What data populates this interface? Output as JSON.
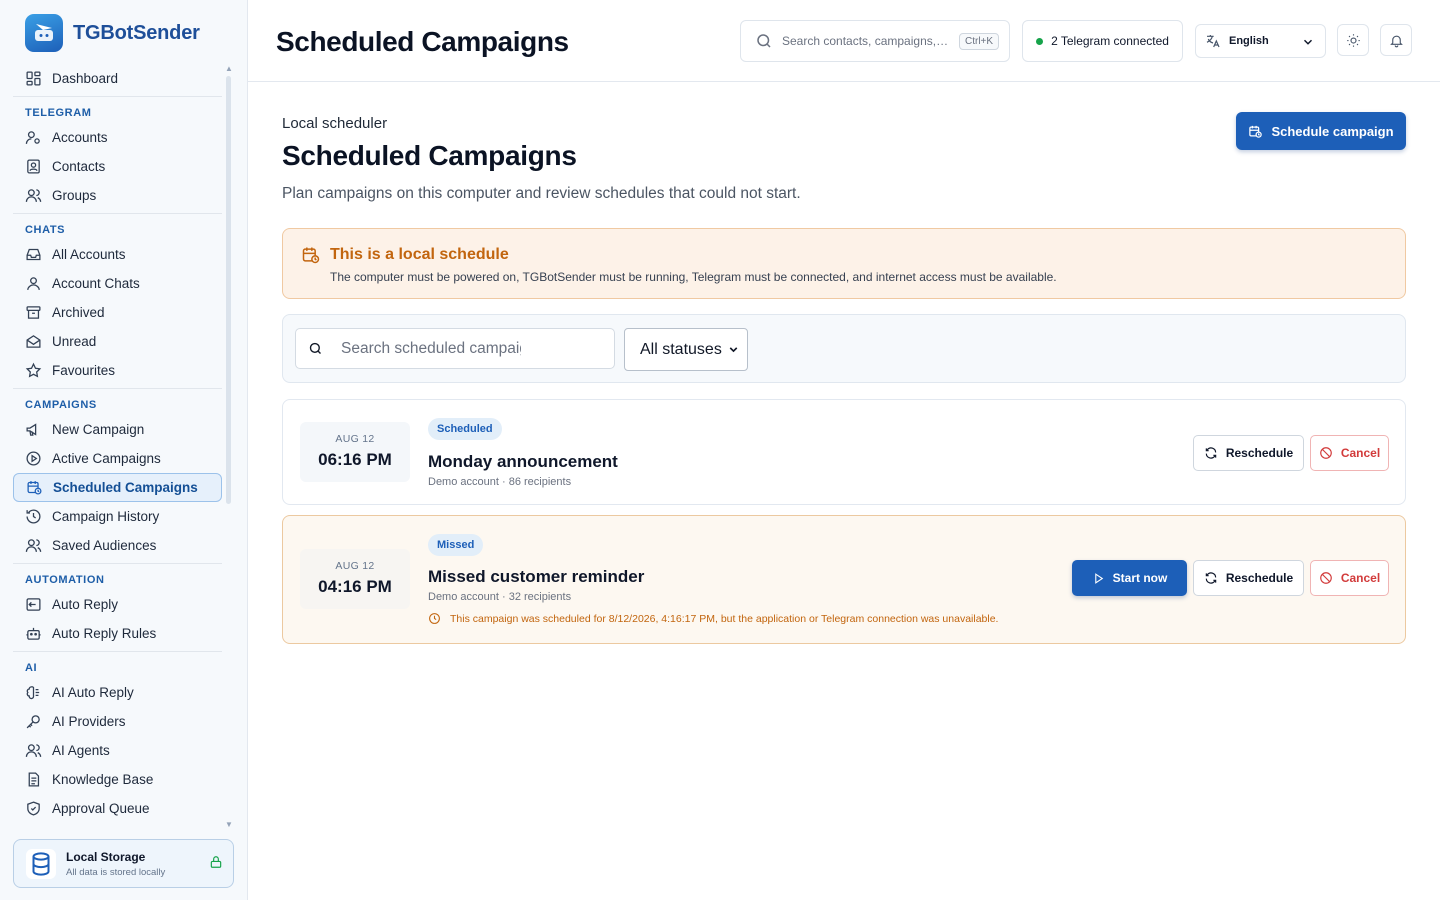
{
  "app": {
    "name": "TGBotSender"
  },
  "sidebar": {
    "top": [
      {
        "label": "Dashboard",
        "icon": "dashboard-icon"
      }
    ],
    "sections": [
      {
        "title": "TELEGRAM",
        "items": [
          {
            "label": "Accounts",
            "icon": "user-cog-icon"
          },
          {
            "label": "Contacts",
            "icon": "contact-book-icon"
          },
          {
            "label": "Groups",
            "icon": "users-icon"
          }
        ]
      },
      {
        "title": "CHATS",
        "items": [
          {
            "label": "All Accounts",
            "icon": "inbox-icon"
          },
          {
            "label": "Account Chats",
            "icon": "user-icon"
          },
          {
            "label": "Archived",
            "icon": "archive-icon"
          },
          {
            "label": "Unread",
            "icon": "mail-open-icon"
          },
          {
            "label": "Favourites",
            "icon": "star-icon"
          }
        ]
      },
      {
        "title": "CAMPAIGNS",
        "items": [
          {
            "label": "New Campaign",
            "icon": "megaphone-icon"
          },
          {
            "label": "Active Campaigns",
            "icon": "play-circle-icon"
          },
          {
            "label": "Scheduled Campaigns",
            "icon": "calendar-clock-icon",
            "active": true
          },
          {
            "label": "Campaign History",
            "icon": "history-icon"
          },
          {
            "label": "Saved Audiences",
            "icon": "users-icon"
          }
        ]
      },
      {
        "title": "AUTOMATION",
        "items": [
          {
            "label": "Auto Reply",
            "icon": "reply-icon"
          },
          {
            "label": "Auto Reply Rules",
            "icon": "bot-icon"
          }
        ]
      },
      {
        "title": "AI",
        "items": [
          {
            "label": "AI Auto Reply",
            "icon": "brain-icon"
          },
          {
            "label": "AI Providers",
            "icon": "key-icon"
          },
          {
            "label": "AI Agents",
            "icon": "users-icon"
          },
          {
            "label": "Knowledge Base",
            "icon": "document-icon"
          },
          {
            "label": "Approval Queue",
            "icon": "shield-check-icon"
          }
        ]
      }
    ],
    "storage": {
      "title": "Local Storage",
      "subtitle": "All data is stored locally"
    }
  },
  "header": {
    "title": "Scheduled Campaigns",
    "search_placeholder": "Search contacts, campaigns, t...",
    "search_shortcut": "Ctrl+K",
    "connection_status": "2 Telegram connected",
    "language": "English"
  },
  "page": {
    "eyebrow": "Local scheduler",
    "title": "Scheduled Campaigns",
    "description": "Plan campaigns on this computer and review schedules that could not start.",
    "primary_action": "Schedule campaign"
  },
  "notice": {
    "title": "This is a local schedule",
    "body": "The computer must be powered on, TGBotSender must be running, Telegram must be connected, and internet access must be available."
  },
  "filters": {
    "search_placeholder": "Search scheduled campaigns",
    "status_selected": "All statuses"
  },
  "campaigns": [
    {
      "date": "AUG 12",
      "time": "06:16 PM",
      "status": "Scheduled",
      "title": "Monday announcement",
      "meta": "Demo account · 86 recipients",
      "actions": {
        "reschedule": "Reschedule",
        "cancel": "Cancel"
      }
    },
    {
      "date": "AUG 12",
      "time": "04:16 PM",
      "status": "Missed",
      "title": "Missed customer reminder",
      "meta": "Demo account · 32 recipients",
      "warning": "This campaign was scheduled for 8/12/2026, 4:16:17 PM, but the application or Telegram connection was unavailable.",
      "actions": {
        "start": "Start now",
        "reschedule": "Reschedule",
        "cancel": "Cancel"
      }
    }
  ],
  "colors": {
    "brand": "#1d5fb8",
    "warning": "#c2650e",
    "danger": "#d23b3b",
    "connected": "#16a34a"
  }
}
